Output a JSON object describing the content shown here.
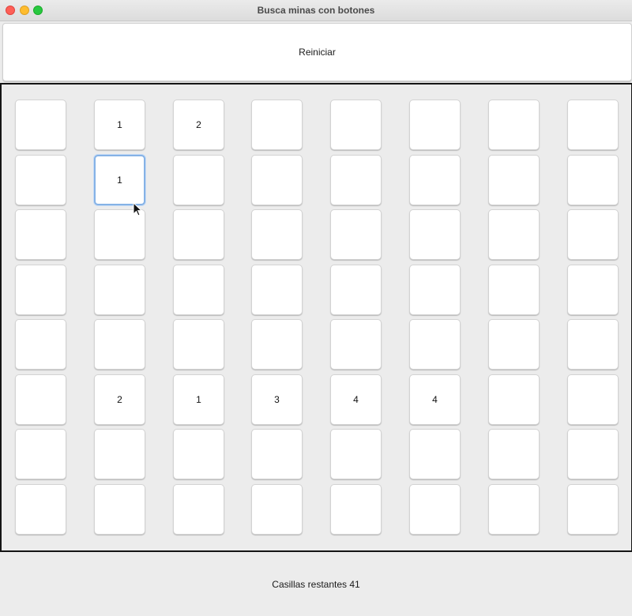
{
  "window": {
    "title": "Busca minas con botones"
  },
  "toolbar": {
    "reset_label": "Reiniciar"
  },
  "board": {
    "rows": 8,
    "cols": 8,
    "focused_cell": {
      "row": 1,
      "col": 1
    },
    "cells": [
      [
        "",
        "1",
        "2",
        "",
        "",
        "",
        "",
        ""
      ],
      [
        "",
        "1",
        "",
        "",
        "",
        "",
        "",
        ""
      ],
      [
        "",
        "",
        "",
        "",
        "",
        "",
        "",
        ""
      ],
      [
        "",
        "",
        "",
        "",
        "",
        "",
        "",
        ""
      ],
      [
        "",
        "",
        "",
        "",
        "",
        "",
        "",
        ""
      ],
      [
        "",
        "2",
        "1",
        "3",
        "4",
        "4",
        "",
        ""
      ],
      [
        "",
        "",
        "",
        "",
        "",
        "",
        "",
        ""
      ],
      [
        "",
        "",
        "",
        "",
        "",
        "",
        "",
        ""
      ]
    ]
  },
  "status": {
    "text": "Casillas restantes 41"
  },
  "icons": {
    "cursor": "mouse-pointer-icon"
  }
}
